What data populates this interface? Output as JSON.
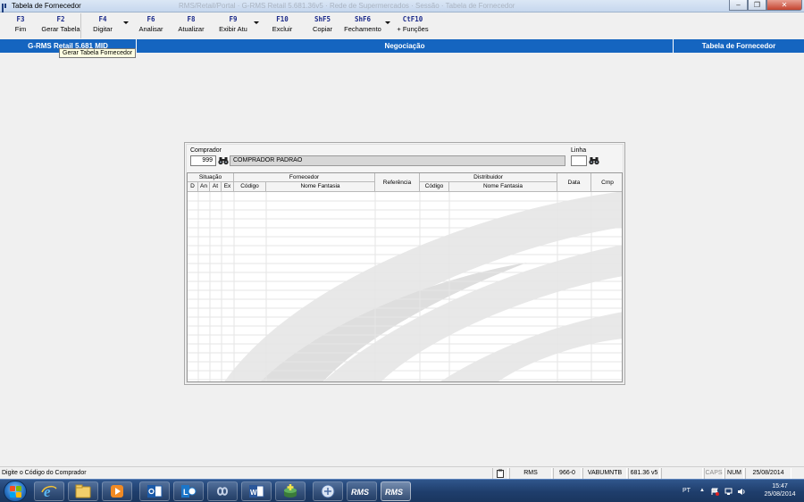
{
  "window": {
    "title": "Tabela de Fornecedor",
    "ghost_title": "RMS/Retail/Portal · G-RMS Retail 5.681.36v5 · Rede de Supermercados · Sessão · Tabela de Fornecedor"
  },
  "toolbar": {
    "items": [
      {
        "key": "F3",
        "label": "Fim"
      },
      {
        "key": "F2",
        "label": "Gerar Tabela"
      },
      {
        "key": "F4",
        "label": "Digitar"
      },
      {
        "key": "F6",
        "label": "Analisar"
      },
      {
        "key": "F8",
        "label": "Atualizar"
      },
      {
        "key": "F9",
        "label": "Exibir Atu"
      },
      {
        "key": "F10",
        "label": "Excluir"
      },
      {
        "key": "ShF5",
        "label": "Copiar"
      },
      {
        "key": "ShF6",
        "label": "Fechamento"
      },
      {
        "key": "CtF10",
        "label": "+ Funções"
      }
    ],
    "tooltip": "Gerar Tabela Fornecedor"
  },
  "header": {
    "product": "G-RMS Retail 5.681 MID",
    "module": "Negociação",
    "screen": "Tabela de Fornecedor"
  },
  "form": {
    "comprador_label": "Comprador",
    "comprador_code": "999",
    "comprador_name": "COMPRADOR PADRAO",
    "linha_label": "Linha",
    "linha_value": ""
  },
  "grid": {
    "group_headers": {
      "situacao": "Situação",
      "fornecedor": "Fornecedor",
      "referencia": "Referência",
      "distribuidor": "Distribuidor",
      "data": "Data",
      "cmp": "Cmp"
    },
    "sub_headers": {
      "d": "D",
      "an": "An",
      "at": "At",
      "ex": "Ex",
      "forn_codigo": "Código",
      "forn_fantasia": "Nome Fantasia",
      "dist_codigo": "Código",
      "dist_fantasia": "Nome Fantasia"
    },
    "rows": []
  },
  "statusbar": {
    "message": "Digite o Código do Comprador",
    "system": "RMS",
    "code": "966-0",
    "user": "VABUMNTB",
    "version": "681.36 v5",
    "caps": "CAPS",
    "num": "NUM",
    "date": "25/08/2014"
  },
  "taskbar": {
    "language": "PT",
    "time": "15:47",
    "date": "25/08/2014",
    "rms_label": "RMS"
  },
  "colors": {
    "header_band": "#1565c0",
    "toolbar_key": "#1b2a8a",
    "taskbar": "#1f3e6c"
  }
}
